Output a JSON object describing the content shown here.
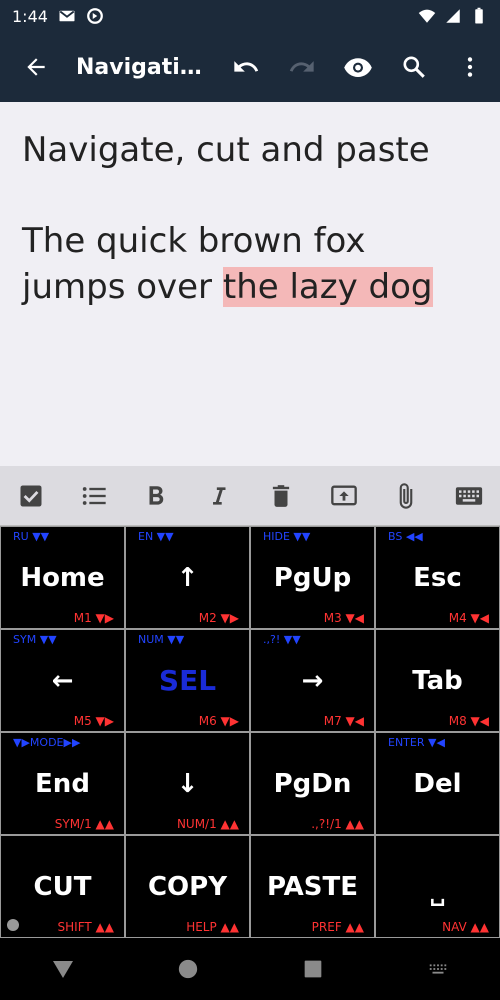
{
  "status_bar": {
    "time": "1:44"
  },
  "app_bar": {
    "title": "Navigati…"
  },
  "editor": {
    "title": "Navigate, cut and paste",
    "body_before": "The quick brown fox jumps over ",
    "body_selected": "the lazy dog"
  },
  "keyboard": {
    "keys": [
      {
        "label": "Home",
        "tl": "RU ▼▼",
        "br": "M1 ▼▶"
      },
      {
        "label": "↑",
        "tl": "EN ▼▼",
        "br": "M2 ▼▶"
      },
      {
        "label": "PgUp",
        "tl": "HIDE ▼▼",
        "br": "M3 ▼◀"
      },
      {
        "label": "Esc",
        "tl": "BS ◀◀",
        "br": "M4 ▼◀"
      },
      {
        "label": "←",
        "tl": "SYM ▼▼",
        "br": "M5 ▼▶"
      },
      {
        "label": "SEL",
        "tl": "NUM ▼▼",
        "br": "M6 ▼▶"
      },
      {
        "label": "→",
        "tl": ".,?! ▼▼",
        "br": "M7 ▼◀"
      },
      {
        "label": "Tab",
        "tl": "",
        "br": "M8 ▼◀"
      },
      {
        "label": "End",
        "tl": "▼▶MODE▶▶",
        "br": "SYM/1 ▲▲"
      },
      {
        "label": "↓",
        "tl": "",
        "br": "NUM/1 ▲▲"
      },
      {
        "label": "PgDn",
        "tl": "",
        "br": ".,?!/1 ▲▲"
      },
      {
        "label": "Del",
        "tl": "ENTER ▼◀",
        "br": ""
      },
      {
        "label": "CUT",
        "tl": "",
        "br": "SHIFT ▲▲"
      },
      {
        "label": "COPY",
        "tl": "",
        "br": "HELP ▲▲"
      },
      {
        "label": "PASTE",
        "tl": "",
        "br": "PREF ▲▲"
      },
      {
        "label": "␣",
        "tl": "",
        "br": "NAV ▲▲"
      }
    ]
  },
  "colors": {
    "toolbar": "#1c2a3a",
    "editor_bg": "#f0eff4",
    "selection": "#f4b8b8",
    "hint_blue": "#2244ff",
    "hint_red": "#ff3333",
    "sel_key": "#1a2bd8"
  }
}
